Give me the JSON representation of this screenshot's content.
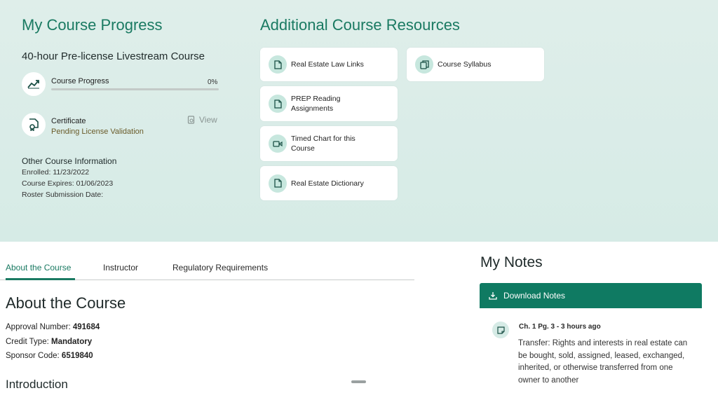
{
  "progress": {
    "title": "My Course Progress",
    "course_name": "40-hour Pre-license Livestream Course",
    "progress_label": "Course Progress",
    "progress_percent_text": "0%",
    "progress_fraction": 0,
    "certificate_label": "Certificate",
    "certificate_status": "Pending License Validation",
    "view_label": "View",
    "other_title": "Other Course Information",
    "enrolled": "Enrolled: 11/23/2022",
    "expires": "Course Expires: 01/06/2023",
    "roster": "Roster Submission Date:"
  },
  "resources": {
    "title": "Additional Course Resources",
    "items": [
      {
        "label": "Real Estate Law Links",
        "icon": "document-icon"
      },
      {
        "label": "Course Syllabus",
        "icon": "copy-icon"
      },
      {
        "label": "PREP Reading Assignments",
        "icon": "document-icon"
      },
      {
        "label": "Timed Chart for this Course",
        "icon": "video-icon"
      },
      {
        "label": "Real Estate Dictionary",
        "icon": "document-icon"
      }
    ]
  },
  "tabs": [
    {
      "label": "About the Course",
      "active": true
    },
    {
      "label": "Instructor",
      "active": false
    },
    {
      "label": "Regulatory Requirements",
      "active": false
    }
  ],
  "about": {
    "title": "About the Course",
    "approval_label": "Approval Number: ",
    "approval_value": "491684",
    "credit_label": "Credit Type: ",
    "credit_value": "Mandatory",
    "sponsor_label": "Sponsor Code: ",
    "sponsor_value": "6519840",
    "intro_title": "Introduction"
  },
  "notes": {
    "title": "My Notes",
    "download_label": "Download Notes",
    "items": [
      {
        "meta": "Ch. 1 Pg. 3 - 3 hours ago",
        "text": "Transfer: Rights and interests in real estate can be bought, sold, assigned, leased, exchanged, inherited, or otherwise transferred from one owner to another"
      }
    ]
  },
  "colors": {
    "accent": "#1a7a62",
    "top_background": "#d6ebe6",
    "button": "#0f7a62"
  }
}
